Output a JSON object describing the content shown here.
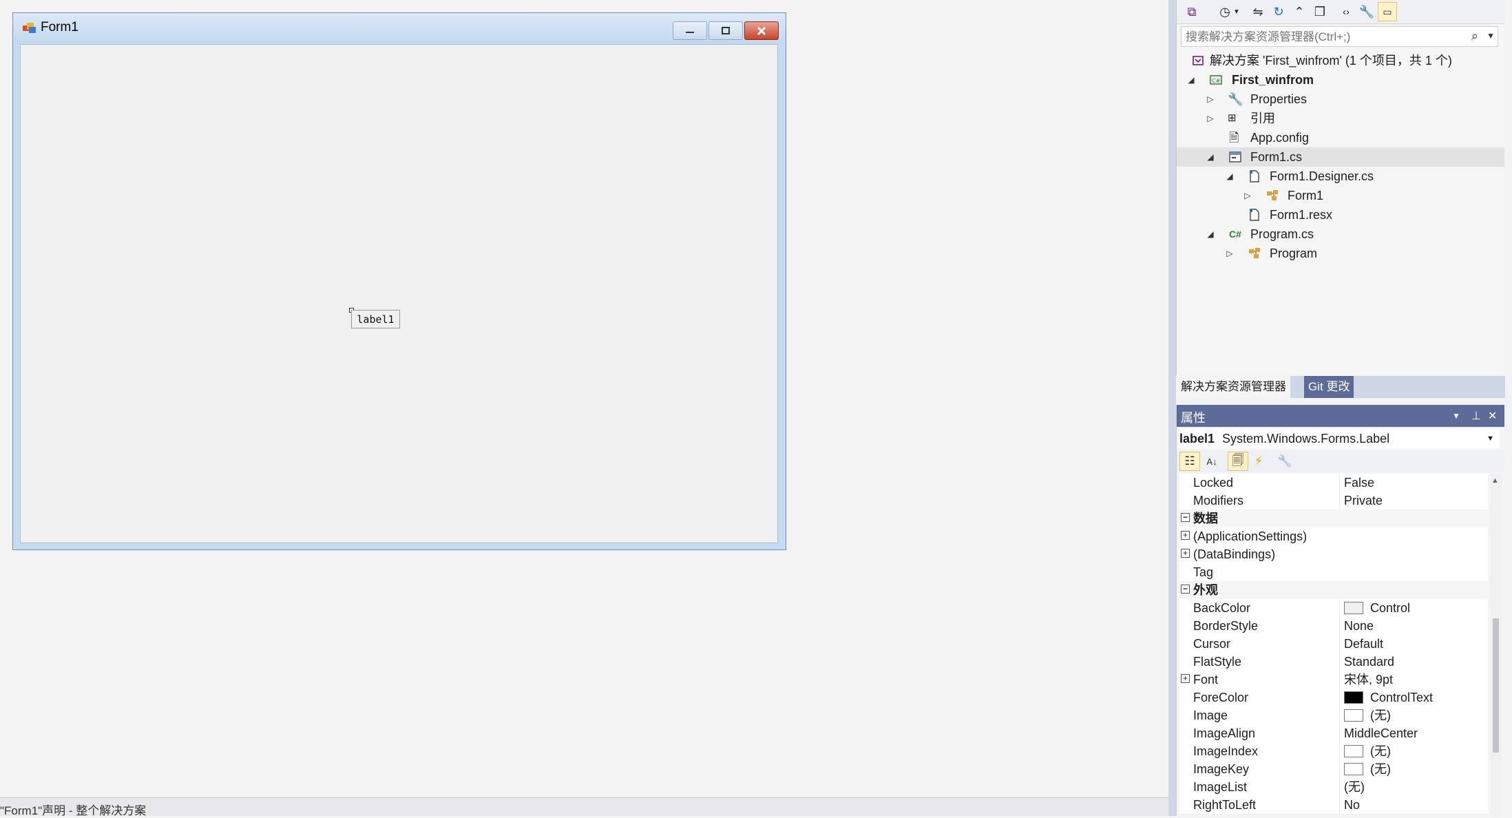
{
  "form": {
    "title": "Form1",
    "label_text": "label1"
  },
  "bottom": {
    "status_text": "\"Form1\"声明 - 整个解决方案"
  },
  "solution_explorer": {
    "search_placeholder": "搜索解决方案资源管理器(Ctrl+;)",
    "tree": [
      {
        "label": "解决方案 'First_winfrom' (1 个项目，共 1 个)",
        "icon": "solution-icon",
        "bold": false
      },
      {
        "label": "First_winfrom",
        "icon": "csharp-project-icon",
        "bold": true
      },
      {
        "label": "Properties",
        "icon": "wrench-icon",
        "bold": false
      },
      {
        "label": "引用",
        "icon": "references-icon",
        "bold": false
      },
      {
        "label": "App.config",
        "icon": "config-file-icon",
        "bold": false
      },
      {
        "label": "Form1.cs",
        "icon": "form-icon",
        "bold": false
      },
      {
        "label": "Form1.Designer.cs",
        "icon": "file-icon",
        "bold": false
      },
      {
        "label": "Form1",
        "icon": "class-icon",
        "bold": false
      },
      {
        "label": "Form1.resx",
        "icon": "file-icon",
        "bold": false
      },
      {
        "label": "Program.cs",
        "icon": "csharp-file-icon",
        "bold": false
      },
      {
        "label": "Program",
        "icon": "class-icon",
        "bold": false
      }
    ],
    "tabs": {
      "solution": "解决方案资源管理器",
      "git": "Git 更改"
    }
  },
  "properties": {
    "title": "属性",
    "object_name": "label1",
    "object_type": "System.Windows.Forms.Label",
    "rows": [
      {
        "name": "Locked",
        "value": "False"
      },
      {
        "name": "Modifiers",
        "value": "Private"
      },
      {
        "name": "数据",
        "value": ""
      },
      {
        "name": "(ApplicationSettings)",
        "value": ""
      },
      {
        "name": "(DataBindings)",
        "value": ""
      },
      {
        "name": "Tag",
        "value": ""
      },
      {
        "name": "外观",
        "value": ""
      },
      {
        "name": "BackColor",
        "value": "Control"
      },
      {
        "name": "BorderStyle",
        "value": "None"
      },
      {
        "name": "Cursor",
        "value": "Default"
      },
      {
        "name": "FlatStyle",
        "value": "Standard"
      },
      {
        "name": "Font",
        "value": "宋体, 9pt"
      },
      {
        "name": "ForeColor",
        "value": "ControlText"
      },
      {
        "name": "Image",
        "value": "(无)"
      },
      {
        "name": "ImageAlign",
        "value": "MiddleCenter"
      },
      {
        "name": "ImageIndex",
        "value": "(无)"
      },
      {
        "name": "ImageKey",
        "value": "(无)"
      },
      {
        "name": "ImageList",
        "value": "(无)"
      },
      {
        "name": "RightToLeft",
        "value": "No"
      }
    ]
  },
  "colors": {
    "accent": "#5d6b99",
    "back_color_swatch": "#f0f0f0",
    "fore_color_swatch": "#000000",
    "close_button": "#c8452a"
  }
}
